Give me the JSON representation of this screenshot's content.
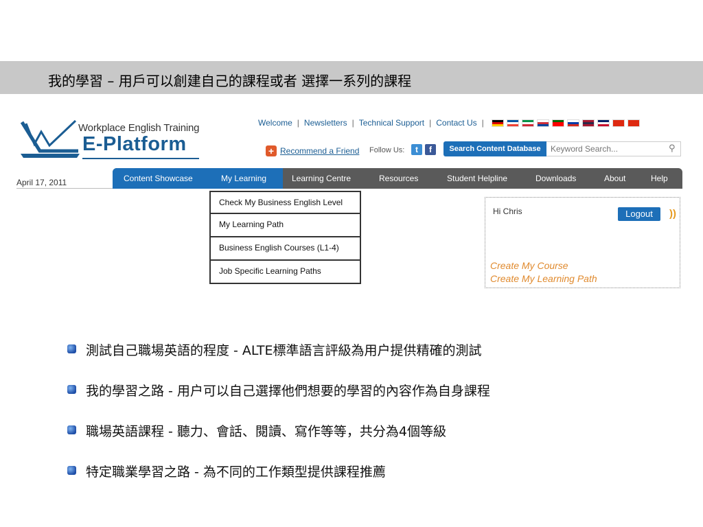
{
  "slide": {
    "title": "我的學習 – 用戶可以創建自己的課程或者 選擇一系列的課程"
  },
  "logo": {
    "line1": "Workplace English Training",
    "line2": "E-Platform"
  },
  "top_links": [
    "Welcome",
    "Newsletters",
    "Technical Support",
    "Contact Us"
  ],
  "flags": [
    {
      "name": "germany-flag",
      "colors": [
        "#000000",
        "#dd0000",
        "#ffce00"
      ]
    },
    {
      "name": "france-flag",
      "colors": [
        "#0055a4",
        "#ffffff",
        "#ef4135"
      ]
    },
    {
      "name": "italy-flag",
      "colors": [
        "#009246",
        "#ffffff",
        "#ce2b37"
      ]
    },
    {
      "name": "korea-flag",
      "colors": [
        "#ffffff",
        "#cd2e3a",
        "#0047a0"
      ]
    },
    {
      "name": "portugal-flag",
      "colors": [
        "#006600",
        "#ff0000",
        "#ff0000"
      ]
    },
    {
      "name": "russia-flag",
      "colors": [
        "#ffffff",
        "#0039a6",
        "#d52b1e"
      ]
    },
    {
      "name": "thailand-flag",
      "colors": [
        "#a51931",
        "#2d2a4a",
        "#a51931"
      ]
    },
    {
      "name": "uk-flag",
      "colors": [
        "#012169",
        "#ffffff",
        "#c8102e"
      ]
    },
    {
      "name": "hongkong-flag",
      "colors": [
        "#de2910",
        "#de2910",
        "#de2910"
      ]
    },
    {
      "name": "china-flag",
      "colors": [
        "#de2910",
        "#de2910",
        "#de2910"
      ]
    }
  ],
  "recommend": {
    "icon": "plus-icon",
    "label": "Recommend a Friend",
    "follow_label": "Follow Us:",
    "twitter": "t",
    "facebook": "f"
  },
  "search": {
    "button_label": "Search Content Database",
    "placeholder": "Keyword Search..."
  },
  "date": "April 17, 2011",
  "nav": {
    "items": [
      "Content Showcase",
      "My Learning",
      "Learning Centre",
      "Resources",
      "Student Helpline",
      "Downloads",
      "About",
      "Help"
    ]
  },
  "dropdown": {
    "items": [
      "Check My Business English Level",
      "My Learning Path",
      "Business English Courses (L1-4)",
      "Job Specific Learning Paths"
    ]
  },
  "user_box": {
    "greeting": "Hi Chris",
    "logout_label": "Logout",
    "links": [
      "Create My Course",
      "Create My Learning Path"
    ]
  },
  "bullets": [
    "測試自己職場英語的程度 - ALTE標準語言評級為用户提供精確的測試",
    "我的學習之路 - 用户可以自己選擇他們想要的學習的內容作為自身課程",
    "職場英語課程 - 聽力、會話、閱讀、寫作等等，共分為4個等級",
    "特定職業學習之路 - 為不同的工作類型提供課程推薦"
  ],
  "colors": {
    "title_bar": "#c8c8c8",
    "brand_blue": "#1d6fb8",
    "nav_gray": "#5a5a5a",
    "link_orange": "#e08a2e"
  }
}
